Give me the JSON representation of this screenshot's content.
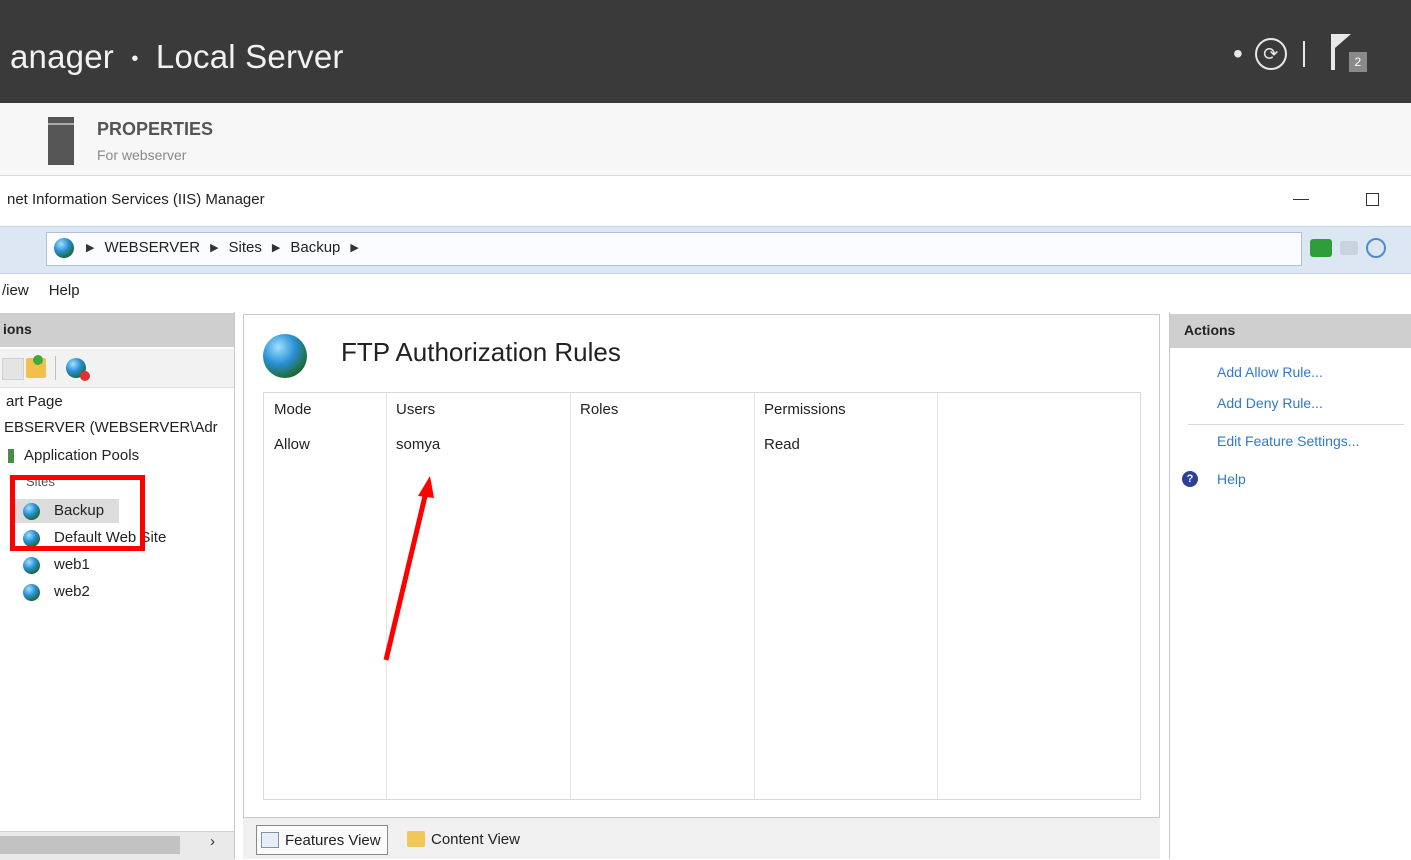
{
  "server_manager": {
    "breadcrumb_prefix": "anager",
    "breadcrumb_sep": "•",
    "breadcrumb_current": "Local Server",
    "notification_count": "2"
  },
  "properties": {
    "title": "PROPERTIES",
    "subtitle": "For webserver"
  },
  "iis_window": {
    "title": "net Information Services (IIS) Manager"
  },
  "address": {
    "crumbs": [
      "WEBSERVER",
      "Sites",
      "Backup"
    ]
  },
  "menu": {
    "items": [
      "/iew",
      "Help"
    ]
  },
  "connections": {
    "header": "ions",
    "tree": {
      "start_page": "art Page",
      "server": "EBSERVER (WEBSERVER\\Adr",
      "app_pools": "Application Pools",
      "sites": "Sites",
      "site_items": [
        "Backup",
        "Default Web Site",
        "web1",
        "web2"
      ]
    }
  },
  "feature": {
    "title": "FTP Authorization Rules",
    "columns": [
      "Mode",
      "Users",
      "Roles",
      "Permissions"
    ],
    "rows": [
      {
        "mode": "Allow",
        "users": "somya",
        "roles": "",
        "permissions": "Read"
      }
    ]
  },
  "tabs": {
    "features_view": "Features View",
    "content_view": "Content View"
  },
  "actions": {
    "header": "Actions",
    "links": [
      "Add Allow Rule...",
      "Add Deny Rule...",
      "Edit Feature Settings..."
    ],
    "help": "Help"
  },
  "colors": {
    "accent_link": "#2f7ac8",
    "annotation": "#ff0000",
    "titlebar": "#3a3a3a"
  }
}
